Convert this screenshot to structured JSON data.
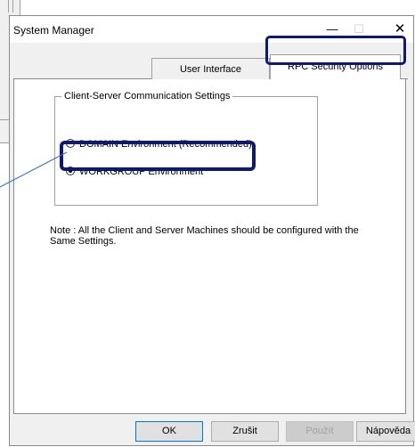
{
  "dialog": {
    "title": "System Manager",
    "window_buttons": {
      "minimize": "—",
      "maximize": "☐",
      "close": "✕"
    }
  },
  "tabs": [
    {
      "label": "User Interface",
      "active": false
    },
    {
      "label": "RPC Security Options",
      "active": true
    }
  ],
  "group": {
    "label": "Client-Server Communication Settings",
    "options": [
      {
        "label": "DOMAIN Environment (Recommended)",
        "selected": false
      },
      {
        "label": "WORKGROUP Environment",
        "selected": true
      }
    ]
  },
  "note": "Note : All the Client and Server Machines should be configured with the Same Settings.",
  "buttons": {
    "ok": "OK",
    "cancel": "Zrušit",
    "apply": "Použít",
    "help": "Nápověda"
  },
  "colors": {
    "highlight": "#0d1a6e",
    "connector": "#3a6fc4"
  }
}
